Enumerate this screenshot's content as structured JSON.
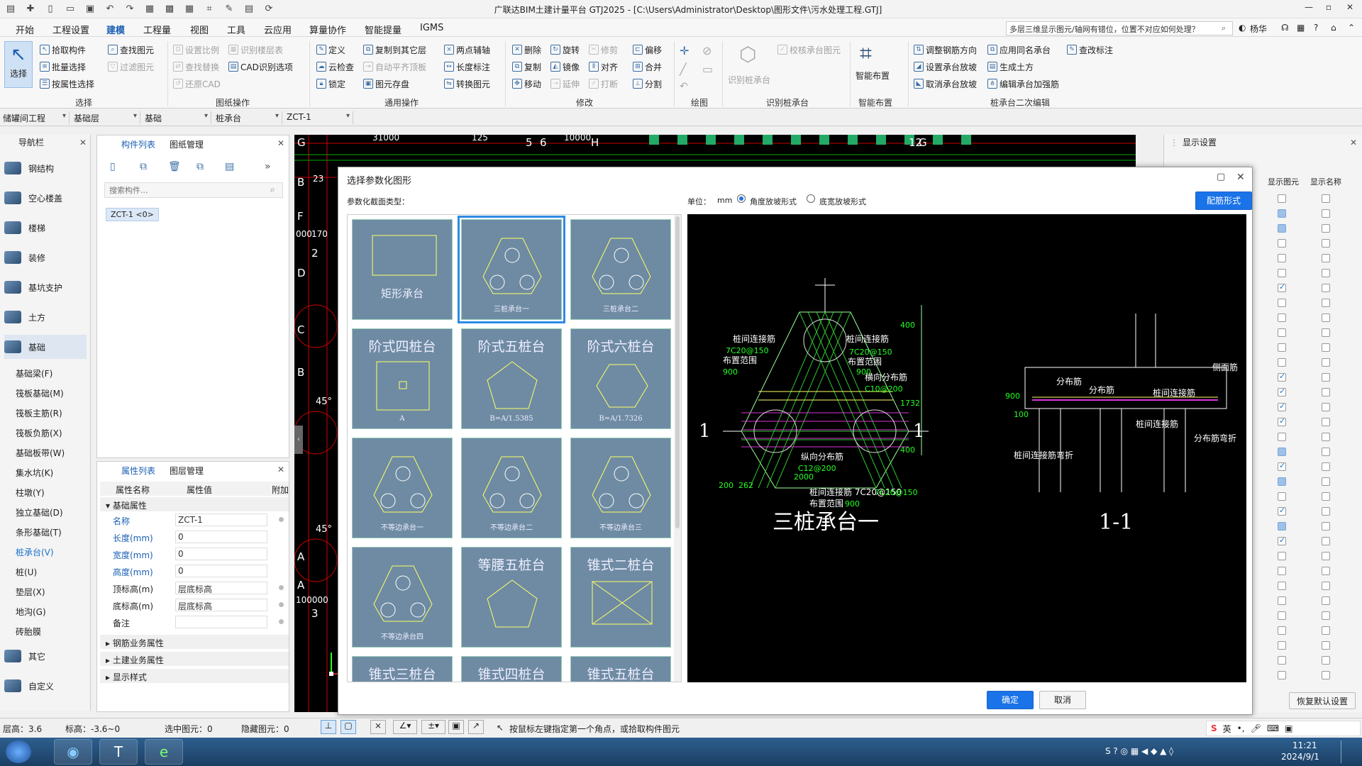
{
  "window": {
    "title": "广联达BIM土建计量平台 GTJ2025 - [C:\\Users\\Administrator\\Desktop\\图形文件\\污水处理工程.GTJ]",
    "controls": [
      "—",
      "▫",
      "✕"
    ]
  },
  "menu": {
    "items": [
      "开始",
      "工程设置",
      "建模",
      "工程量",
      "视图",
      "工具",
      "云应用",
      "算量协作",
      "智能提量",
      "IGMS"
    ],
    "active": "建模",
    "question": "多层三维显示图元/轴网有错位，位置不对应如何处理？",
    "user": "杨华"
  },
  "ribbon": {
    "select_label": "选择",
    "select_group": [
      "拾取构件",
      "批量选择",
      "按属性选择"
    ],
    "find_group": [
      "查找图元",
      "过滤图元"
    ],
    "drawing_ops": [
      "设置比例",
      "识别楼层表",
      "查找替换",
      "CAD识别选项",
      "还原CAD"
    ],
    "general_ops": [
      "定义",
      "复制到其它层",
      "两点辅轴",
      "云检查",
      "自动平齐顶板",
      "长度标注",
      "锁定",
      "图元存盘",
      "转换图元"
    ],
    "modify_ops": [
      "删除",
      "旋转",
      "修剪",
      "偏移",
      "复制",
      "镜像",
      "对齐",
      "合并",
      "移动",
      "延伸",
      "打断",
      "分割"
    ],
    "identify_cap": [
      "识别桩承台",
      "校核承台图元"
    ],
    "smart_layout": "智能布置",
    "cap_edit": [
      "调整钢筋方向",
      "应用同名承台",
      "查改标注",
      "设置承台放坡",
      "生成土方",
      "取消承台放坡",
      "编辑承台加强筋"
    ],
    "groups": [
      "选择",
      "图纸操作",
      "通用操作",
      "修改",
      "绘图",
      "识别桩承台",
      "智能布置",
      "桩承台二次编辑"
    ]
  },
  "combos": [
    "储罐间工程",
    "基础层",
    "基础",
    "桩承台",
    "ZCT-1"
  ],
  "nav": {
    "title": "导航栏",
    "big": [
      "钢结构",
      "空心楼盖",
      "楼梯",
      "装修",
      "基坑支护",
      "土方",
      "基础",
      "其它",
      "自定义"
    ],
    "active": "基础",
    "sub": [
      "基础梁(F)",
      "筏板基础(M)",
      "筏板主筋(R)",
      "筏板负筋(X)",
      "基础板带(W)",
      "集水坑(K)",
      "柱墩(Y)",
      "独立基础(D)",
      "条形基础(T)",
      "桩承台(V)",
      "桩(U)",
      "垫层(X)",
      "地沟(G)",
      "砖胎膜"
    ],
    "active_sub": "桩承台(V)"
  },
  "complist": {
    "tabs": [
      "构件列表",
      "图纸管理"
    ],
    "search_placeholder": "搜索构件...",
    "items": [
      "ZCT-1 <0>"
    ]
  },
  "props": {
    "tabs": [
      "属性列表",
      "图层管理"
    ],
    "headers": [
      "属性名称",
      "属性值",
      "附加"
    ],
    "section": "基础属性",
    "rows": [
      {
        "name": "名称",
        "value": "ZCT-1",
        "blue": true
      },
      {
        "name": "长度(mm)",
        "value": "0",
        "blue": true
      },
      {
        "name": "宽度(mm)",
        "value": "0",
        "blue": true
      },
      {
        "name": "高度(mm)",
        "value": "0",
        "blue": true
      },
      {
        "name": "顶标高(m)",
        "value": "层底标高",
        "blue": false
      },
      {
        "name": "底标高(m)",
        "value": "层底标高",
        "blue": false
      },
      {
        "name": "备注",
        "value": "",
        "blue": false
      }
    ],
    "more_sections": [
      "钢筋业务属性",
      "土建业务属性",
      "显示样式"
    ]
  },
  "display": {
    "title": "显示设置",
    "col1": "显示图元",
    "col2": "显示名称",
    "restore": "恢复默认设置"
  },
  "dialog": {
    "title": "选择参数化图形",
    "type_label": "参数化截面类型：",
    "unit_label": "单位：",
    "unit": "mm",
    "radio1": "角度放坡形式",
    "radio2": "底宽放坡形式",
    "rebar_btn": "配筋形式",
    "ok": "确定",
    "cancel": "取消",
    "shapes": [
      {
        "name": "矩形承台",
        "style": "mid"
      },
      {
        "name": "三桩承台一",
        "style": "small"
      },
      {
        "name": "三桩承台二",
        "style": "small"
      },
      {
        "name": "阶式四桩台",
        "style": "big",
        "sub": "A"
      },
      {
        "name": "阶式五桩台",
        "style": "big",
        "sub": "B=A/1.5385"
      },
      {
        "name": "阶式六桩台",
        "style": "big",
        "sub": "B=A/1.7326"
      },
      {
        "name": "不等边承台一",
        "style": "small"
      },
      {
        "name": "不等边承台二",
        "style": "small"
      },
      {
        "name": "不等边承台三",
        "style": "small"
      },
      {
        "name": "不等边承台四",
        "style": "small"
      },
      {
        "name": "等腰五桩台",
        "style": "big"
      },
      {
        "name": "锥式二桩台",
        "style": "big"
      },
      {
        "name": "锥式三桩台",
        "style": "big"
      },
      {
        "name": "锥式四桩台",
        "style": "big"
      },
      {
        "name": "锥式五桩台",
        "style": "big"
      }
    ],
    "preview": {
      "title": "三桩承台一",
      "section": "1-1",
      "labels": [
        "桩间连接筋",
        "7C20@150",
        "布置范围",
        "900",
        "横向分布筋",
        "C10@200",
        "纵向分布筋",
        "C12@200",
        "桩间连接筋 7C20@150",
        "布置范围900",
        "分布筋",
        "侧面筋",
        "分布筋弯折",
        "桩间连接筋弯折",
        "1"
      ],
      "dims": [
        "400",
        "1732",
        "400",
        "200",
        "262",
        "2000",
        "900",
        "100"
      ]
    }
  },
  "canvas": {
    "axis_labels": [
      "G",
      "B",
      "F",
      "D",
      "C",
      "2",
      "B",
      "A",
      "A",
      "3",
      "12",
      "G",
      "H",
      "5",
      "6",
      "45°",
      "45°",
      "31000",
      "125",
      "10000",
      "23",
      "000",
      "170",
      "100000"
    ]
  },
  "status": {
    "floor": "层高：3.6",
    "elev": "标高：-3.6~0",
    "selected": "选中图元：0",
    "hidden": "隐藏图元：0",
    "hint": "按鼠标左键指定第一个角点，或拾取构件图元"
  },
  "taskbar": {
    "time": "11:21",
    "date": "2024/9/1",
    "ime": "英"
  }
}
